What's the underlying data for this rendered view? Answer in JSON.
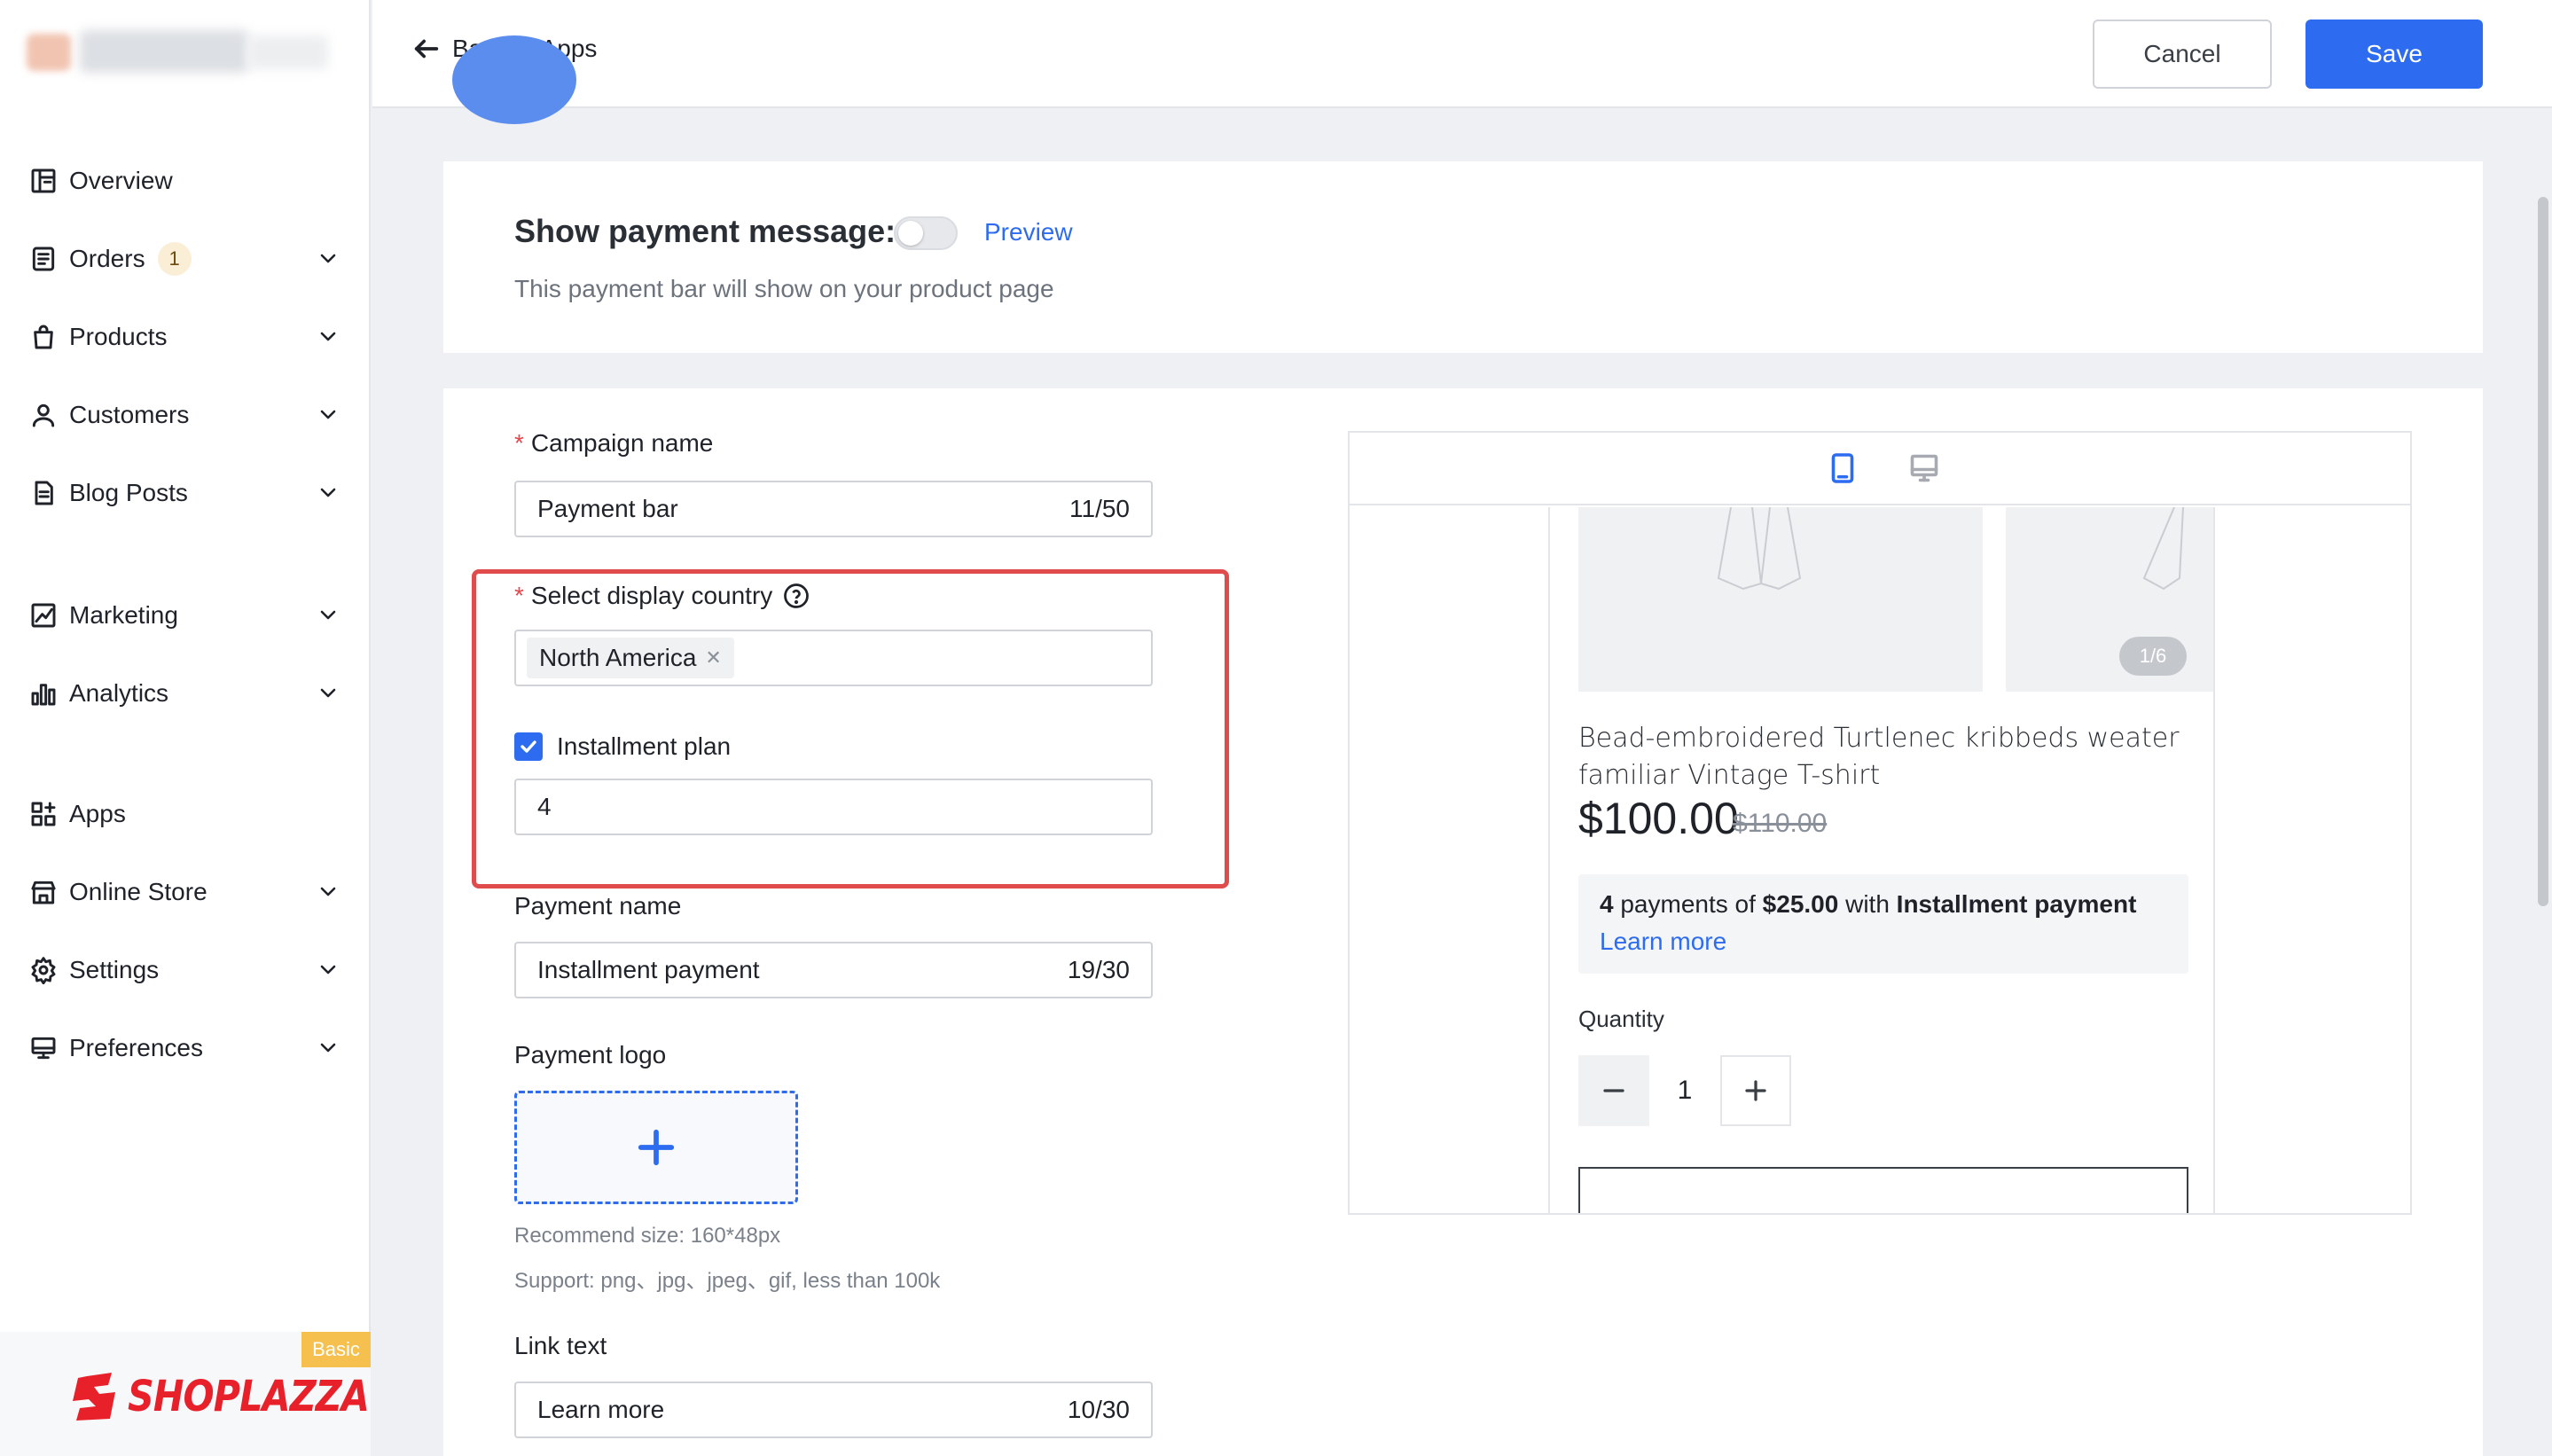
{
  "sidebar": {
    "items": [
      {
        "label": "Overview",
        "icon": "overview-icon"
      },
      {
        "label": "Orders",
        "icon": "orders-icon",
        "badge": "1"
      },
      {
        "label": "Products",
        "icon": "products-icon"
      },
      {
        "label": "Customers",
        "icon": "customers-icon"
      },
      {
        "label": "Blog Posts",
        "icon": "blog-posts-icon"
      },
      {
        "label": "Marketing",
        "icon": "marketing-icon"
      },
      {
        "label": "Analytics",
        "icon": "analytics-icon"
      },
      {
        "label": "Apps",
        "icon": "apps-icon"
      },
      {
        "label": "Online Store",
        "icon": "online-store-icon"
      },
      {
        "label": "Settings",
        "icon": "settings-icon"
      },
      {
        "label": "Preferences",
        "icon": "preferences-icon"
      }
    ],
    "plan_tag": "Basic",
    "brand": "SHOPLAZZA"
  },
  "topbar": {
    "back_label": "Back to Apps",
    "cancel_label": "Cancel",
    "save_label": "Save"
  },
  "payment_message": {
    "title": "Show payment message:",
    "preview_label": "Preview",
    "subtitle": "This payment bar will show on your product page",
    "enabled": false
  },
  "form": {
    "campaign": {
      "label": "Campaign name",
      "value": "Payment bar",
      "counter": "11/50"
    },
    "country": {
      "label": "Select display country",
      "selected": "North America"
    },
    "installment": {
      "label": "Installment plan",
      "checked": true,
      "value": "4"
    },
    "payment_name": {
      "label": "Payment name",
      "value": "Installment payment",
      "counter": "19/30"
    },
    "payment_logo": {
      "label": "Payment logo",
      "hint_size": "Recommend size: 160*48px",
      "hint_support": "Support: png、jpg、jpeg、gif, less than 100k"
    },
    "link_text": {
      "label": "Link text",
      "value": "Learn more",
      "counter": "10/30"
    }
  },
  "preview": {
    "pager": "1/6",
    "product_title": "Bead-embroidered Turtlenec kribbeds weater familiar Vintage T-shirt",
    "price": "$100.00",
    "old_price": "$110.00",
    "payment_line": {
      "count": "4",
      "text1": " payments of ",
      "amount": "$25.00",
      "text2": " with ",
      "name": "Installment payment"
    },
    "learn_more": "Learn more",
    "quantity_label": "Quantity",
    "quantity": "1"
  },
  "colors": {
    "accent": "#2d6cf0",
    "highlight": "#e04b4b",
    "brand": "#e8202a",
    "plan_tag": "#f5c04d"
  }
}
